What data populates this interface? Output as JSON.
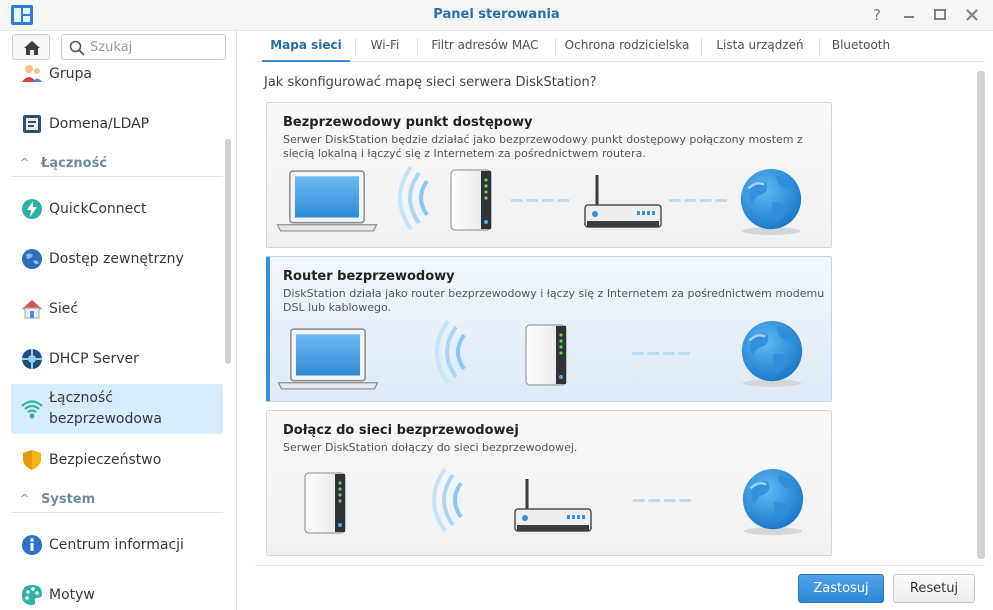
{
  "window": {
    "title": "Panel sterowania",
    "controls": [
      "help-icon",
      "minimize-icon",
      "maximize-icon",
      "close-icon"
    ]
  },
  "sidebar": {
    "search_placeholder": "Szukaj",
    "items": [
      {
        "label": "Grupa",
        "icon": "group-icon"
      },
      {
        "label": "Domena/LDAP",
        "icon": "domain-icon"
      },
      {
        "label": "QuickConnect",
        "icon": "quickconnect-icon"
      },
      {
        "label": "Dostęp zewnętrzny",
        "icon": "external-access-icon"
      },
      {
        "label": "Sieć",
        "icon": "network-icon"
      },
      {
        "label": "DHCP Server",
        "icon": "dhcp-icon"
      },
      {
        "label_line1": "Łączność",
        "label_line2": "bezprzewodowa",
        "icon": "wireless-icon",
        "active": true
      },
      {
        "label": "Bezpieczeństwo",
        "icon": "security-icon"
      },
      {
        "label": "Centrum informacji",
        "icon": "info-icon"
      },
      {
        "label": "Motyw",
        "icon": "theme-icon"
      }
    ],
    "sections": [
      {
        "label": "Łączność"
      },
      {
        "label": "System"
      }
    ]
  },
  "tabs": [
    {
      "label": "Mapa sieci",
      "active": true
    },
    {
      "label": "Wi-Fi"
    },
    {
      "label": "Filtr adresów MAC"
    },
    {
      "label": "Ochrona rodzicielska"
    },
    {
      "label": "Lista urządzeń"
    },
    {
      "label": "Bluetooth"
    }
  ],
  "main": {
    "question": "Jak skonfigurować mapę sieci serwera DiskStation?",
    "options": [
      {
        "title": "Bezprzewodowy punkt dostępowy",
        "description": "Serwer DiskStation będzie działać jako bezprzewodowy punkt dostępowy połączony mostem z siecią lokalną i łączyć się z Internetem za pośrednictwem routera.",
        "selected": false
      },
      {
        "title": "Router bezprzewodowy",
        "description": "DiskStation działa jako router bezprzewodowy i łączy się z Internetem za pośrednictwem modemu DSL lub kablowego.",
        "selected": true
      },
      {
        "title": "Dołącz do sieci bezprzewodowej",
        "description": "Serwer DiskStation dołączy do sieci bezprzewodowej.",
        "selected": false
      }
    ]
  },
  "footer": {
    "apply_label": "Zastosuj",
    "reset_label": "Resetuj"
  },
  "colors": {
    "accent": "#2f86d6",
    "title": "#2d6ea6",
    "active_item_bg": "#d7ebfa"
  }
}
